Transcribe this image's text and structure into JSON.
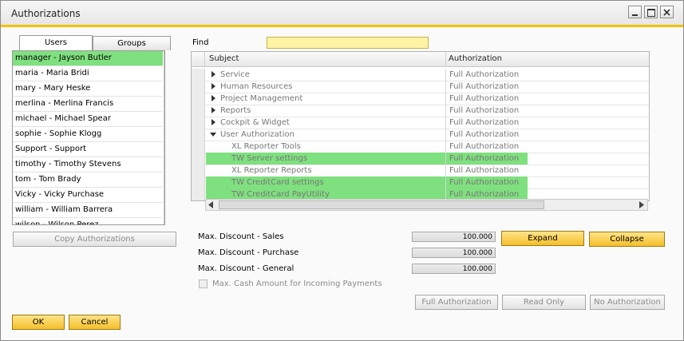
{
  "window": {
    "title": "Authorizations"
  },
  "tabs": {
    "users": "Users",
    "groups": "Groups"
  },
  "users": [
    "manager - Jayson Butler",
    "maria - Maria Bridi",
    "mary - Mary Heske",
    "merlina - Merlina Francis",
    "michael - Michael Spear",
    "sophie - Sophie Klogg",
    "Support - Support",
    "timothy - Timothy Stevens",
    "tom - Tom Brady",
    "Vicky - Vicky Purchase",
    "william - William Barrera",
    "wilson - Wilson Perez"
  ],
  "copy_auth_label": "Copy Authorizations",
  "find": {
    "label": "Find",
    "value": ""
  },
  "grid": {
    "headers": {
      "subject": "Subject",
      "authorization": "Authorization"
    },
    "rows": [
      {
        "subject": "Service",
        "auth": "Full Authorization",
        "level": 0,
        "state": "collapsed",
        "highlight": false
      },
      {
        "subject": "Human Resources",
        "auth": "Full Authorization",
        "level": 0,
        "state": "collapsed",
        "highlight": false
      },
      {
        "subject": "Project Management",
        "auth": "Full Authorization",
        "level": 0,
        "state": "collapsed",
        "highlight": false
      },
      {
        "subject": "Reports",
        "auth": "Full Authorization",
        "level": 0,
        "state": "collapsed",
        "highlight": false
      },
      {
        "subject": "Cockpit & Widget",
        "auth": "Full Authorization",
        "level": 0,
        "state": "collapsed",
        "highlight": false
      },
      {
        "subject": "User Authorization",
        "auth": "Full Authorization",
        "level": 0,
        "state": "expanded",
        "highlight": false
      },
      {
        "subject": "XL Reporter Tools",
        "auth": "Full Authorization",
        "level": 1,
        "state": "leaf",
        "highlight": false
      },
      {
        "subject": "TW Server settings",
        "auth": "Full Authorization",
        "level": 1,
        "state": "leaf",
        "highlight": true
      },
      {
        "subject": "XL Reporter Reports",
        "auth": "Full Authorization",
        "level": 1,
        "state": "leaf",
        "highlight": false
      },
      {
        "subject": "TW CreditCard settings",
        "auth": "Full Authorization",
        "level": 1,
        "state": "leaf",
        "highlight": true
      },
      {
        "subject": "TW CreditCard PayUtility",
        "auth": "Full Authorization",
        "level": 1,
        "state": "leaf",
        "highlight": true
      }
    ]
  },
  "discounts": {
    "sales_label": "Max. Discount - Sales",
    "sales_value": "100.000",
    "purchase_label": "Max. Discount - Purchase",
    "purchase_value": "100.000",
    "general_label": "Max. Discount - General",
    "general_value": "100.000"
  },
  "buttons": {
    "expand": "Expand",
    "collapse": "Collapse",
    "full_auth": "Full Authorization",
    "read_only": "Read Only",
    "no_auth": "No Authorization",
    "ok": "OK",
    "cancel": "Cancel"
  },
  "cash_checkbox_label": "Max. Cash Amount for Incoming Payments",
  "colors": {
    "accent": "#f2c200",
    "highlight": "#7fe07f",
    "find_bg": "#fff3a6"
  }
}
